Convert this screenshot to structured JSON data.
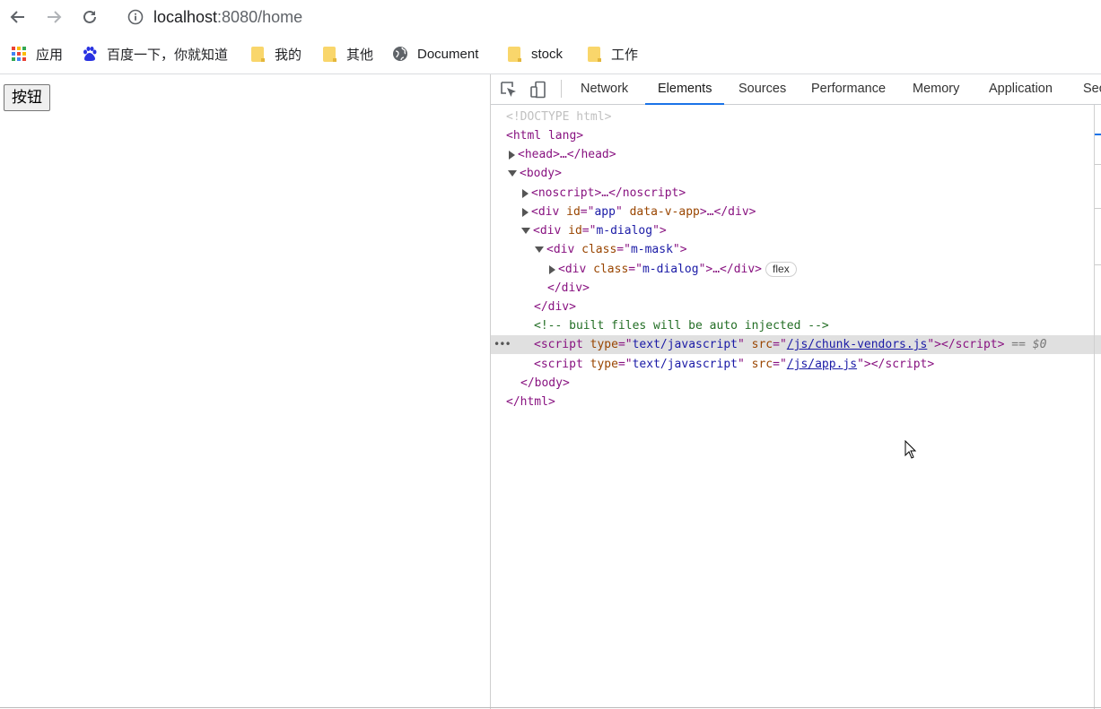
{
  "browser": {
    "url_host": "localhost",
    "url_path": ":8080/home",
    "icons": {
      "back": "arrow-left-icon",
      "forward": "arrow-right-icon",
      "reload": "reload-icon",
      "site_info": "info-icon"
    },
    "bookmarks": [
      {
        "label": "应用",
        "icon": "apps-grid-icon"
      },
      {
        "label": "百度一下，你就知道",
        "icon": "baidu-paw-icon"
      },
      {
        "label": "我的",
        "icon": "folder-icon"
      },
      {
        "label": "其他",
        "icon": "folder-icon"
      },
      {
        "label": "Document",
        "icon": "globe-icon"
      },
      {
        "label": "stock",
        "icon": "folder-icon"
      },
      {
        "label": "工作",
        "icon": "folder-icon"
      }
    ]
  },
  "page": {
    "button_label": "按钮"
  },
  "devtools": {
    "tabs": [
      "Network",
      "Elements",
      "Sources",
      "Performance",
      "Memory",
      "Application",
      "Sec"
    ],
    "active_tab": "Elements",
    "accent_color": "#1a73e8",
    "dom": {
      "doctype": "<!DOCTYPE html>",
      "html_open": "<html lang>",
      "head": "<head>…</head>",
      "body_open": "<body>",
      "noscript": "<noscript>…</noscript>",
      "div_app": {
        "tag": "<div ",
        "attr": "id",
        "eq": "=\"",
        "val": "app",
        "close": "\" ",
        "attr2": "data-v-app",
        "tail": ">…</div>"
      },
      "div_dialog": {
        "tag": "<div ",
        "attr": "id",
        "val": "m-dialog"
      },
      "div_mask": {
        "tag": "<div ",
        "attr": "class",
        "val": "m-mask"
      },
      "div_inner": {
        "tag": "<div ",
        "attr": "class",
        "val": "m-dialog",
        "tail": ">…</div>",
        "badge": "flex"
      },
      "div_close": "</div>",
      "comment": "<!-- built files will be auto injected -->",
      "script1": {
        "attr": "type",
        "val": "text/javascript",
        "attr2": "src",
        "src": "/js/chunk-vendors.js",
        "suffix": "== $0"
      },
      "script2": {
        "attr": "type",
        "val": "text/javascript",
        "attr2": "src",
        "src": "/js/app.js"
      },
      "body_close": "</body>",
      "html_close": "</html>",
      "selected_dots": "•••"
    }
  }
}
